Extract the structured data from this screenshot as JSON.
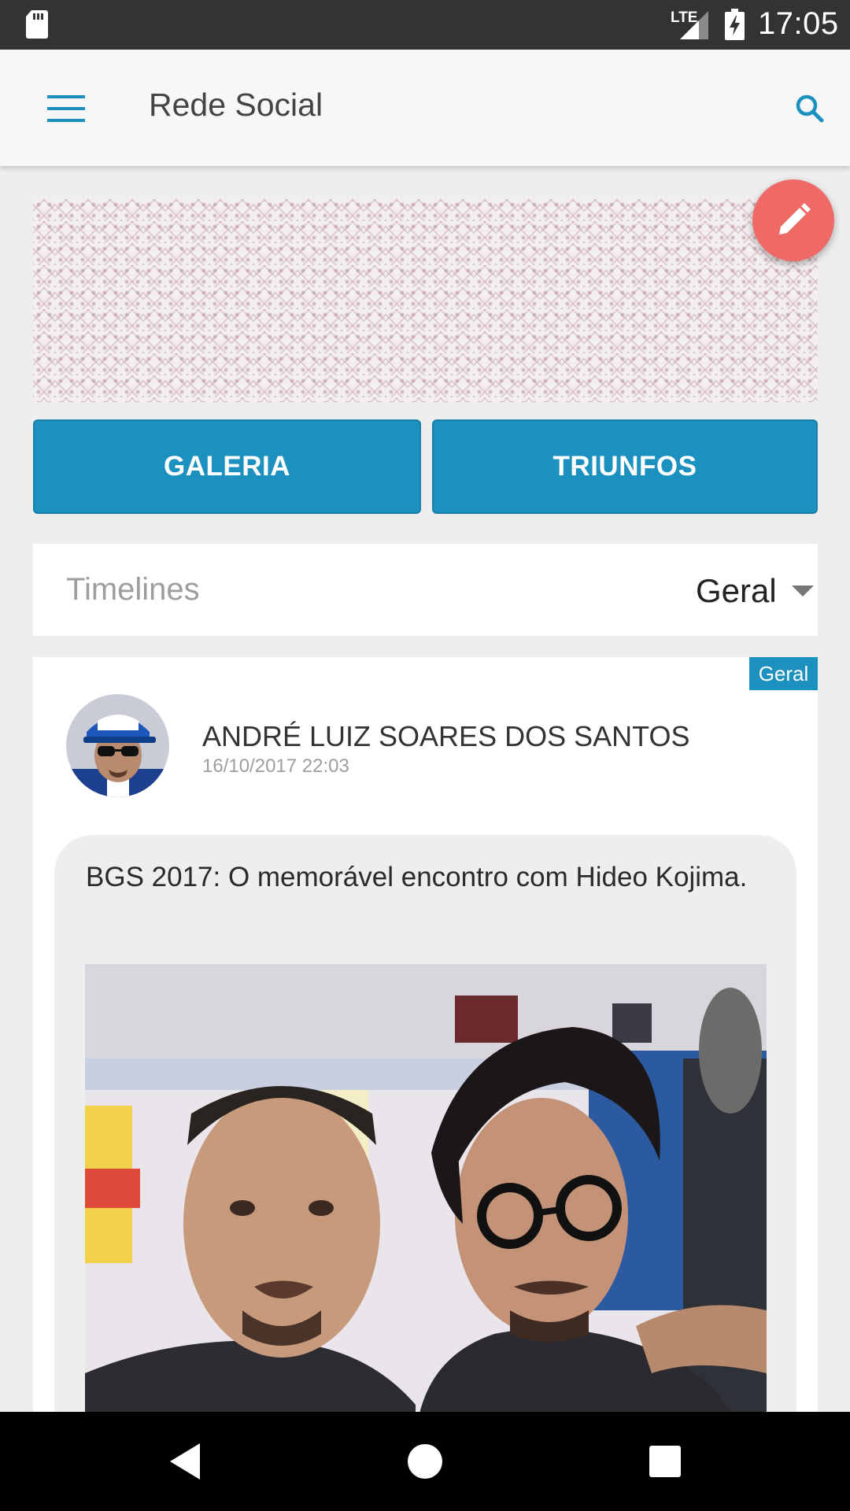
{
  "status_bar": {
    "time": "17:05",
    "network": "LTE",
    "icons": [
      "sd-card-icon",
      "signal-icon",
      "battery-charging-icon"
    ]
  },
  "app_bar": {
    "title": "Rede Social",
    "menu_icon": "hamburger-menu-icon",
    "search_icon": "search-icon",
    "accent_color": "#1c91c0"
  },
  "fab": {
    "icon": "pencil-icon",
    "color": "#ef6a67"
  },
  "actions": {
    "galeria_label": "GALERIA",
    "triunfos_label": "TRIUNFOS"
  },
  "timelines": {
    "label": "Timelines",
    "selected": "Geral"
  },
  "post": {
    "badge": "Geral",
    "author": "ANDRÉ LUIZ SOARES DOS SANTOS",
    "date": "16/10/2017 22:03",
    "text": "BGS 2017: O memorável encontro com Hideo Kojima."
  },
  "nav_bar": {
    "icons": [
      "back-icon",
      "home-icon",
      "recents-icon"
    ]
  }
}
